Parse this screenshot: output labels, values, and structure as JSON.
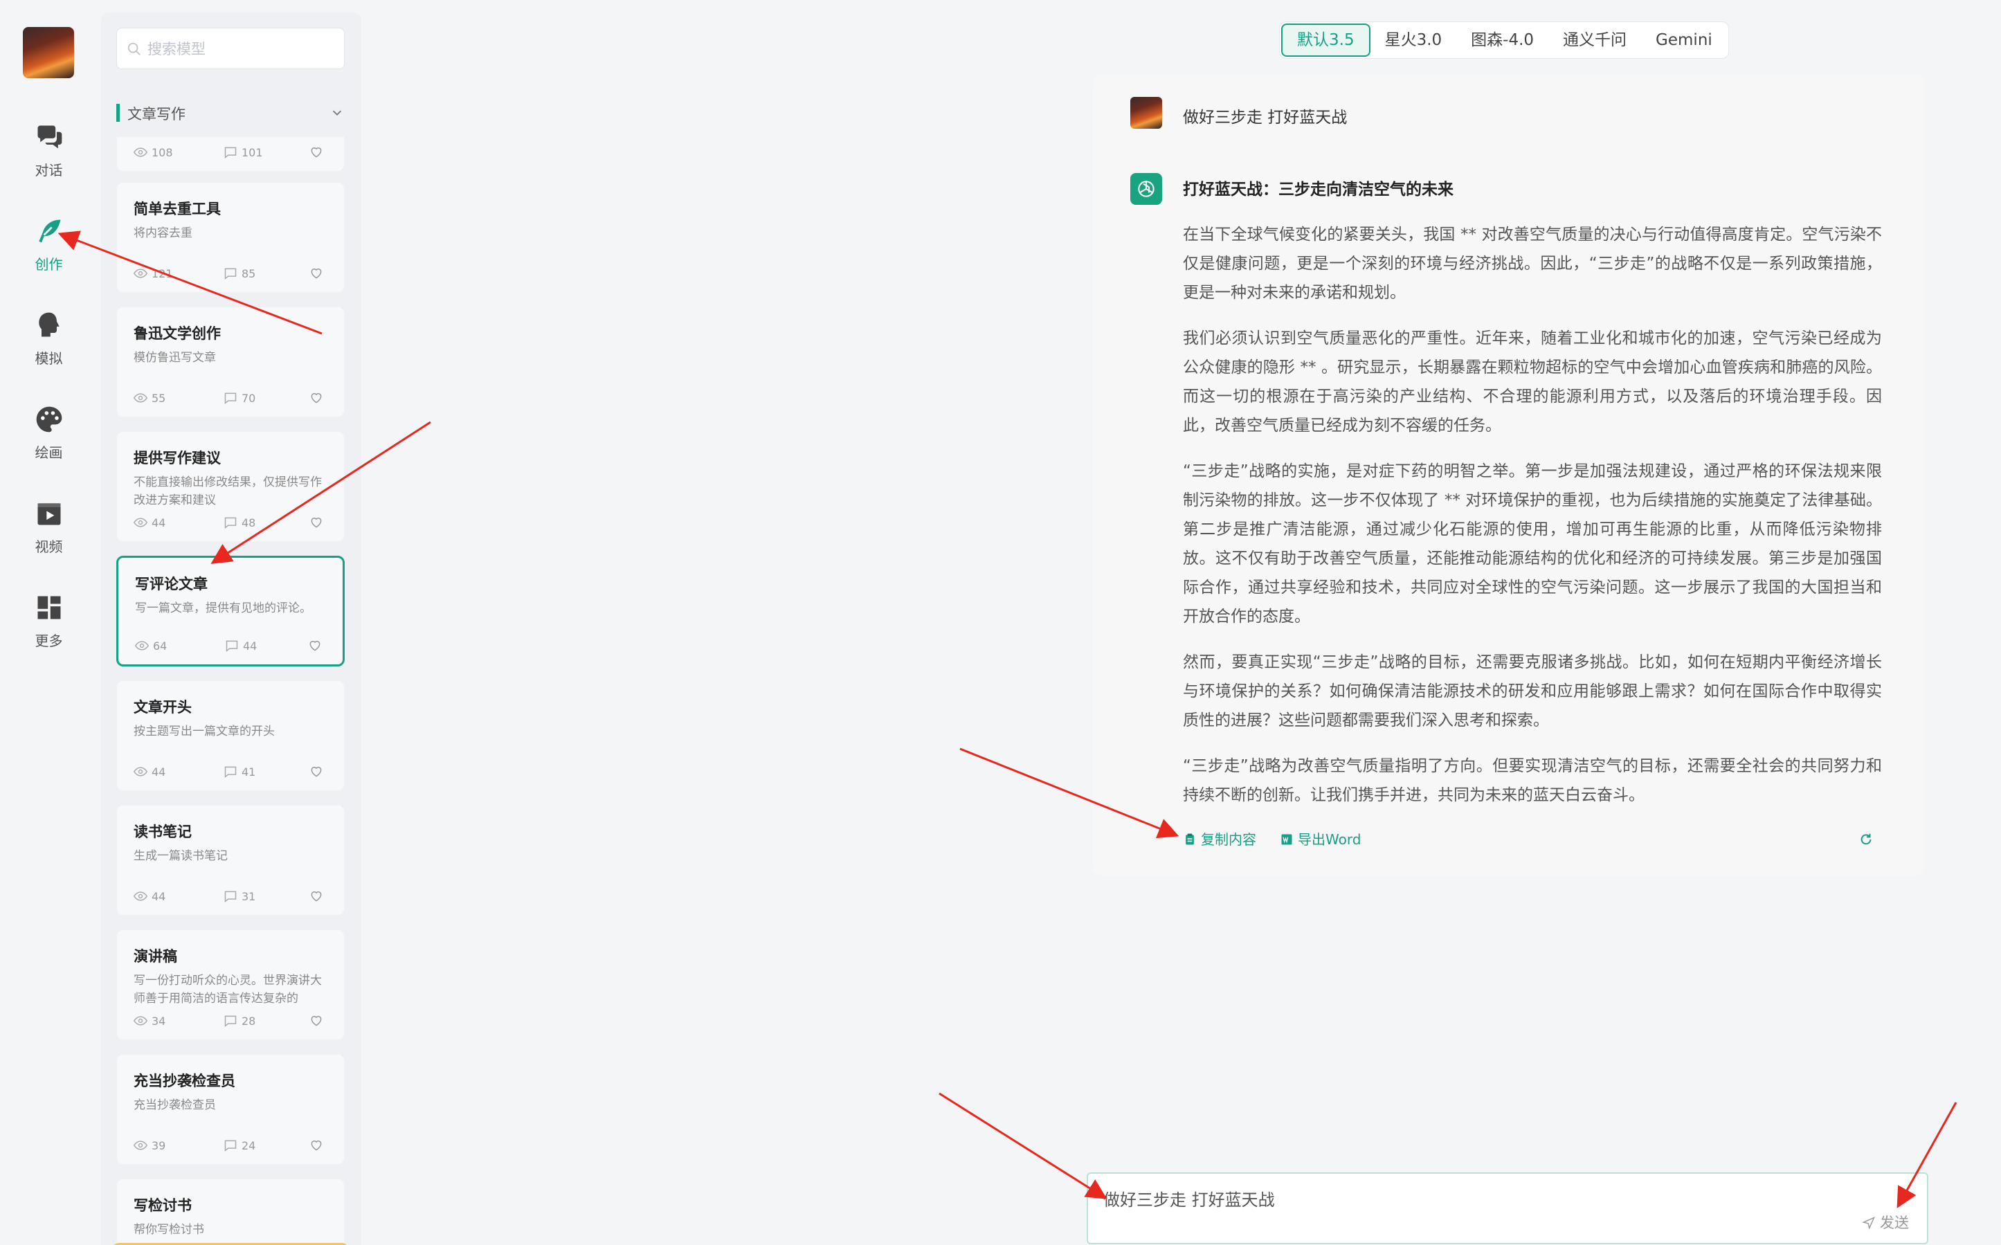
{
  "rail": {
    "items": [
      {
        "label": "对话",
        "icon": "chat-icon"
      },
      {
        "label": "创作",
        "icon": "feather-icon"
      },
      {
        "label": "模拟",
        "icon": "head-icon"
      },
      {
        "label": "绘画",
        "icon": "palette-icon"
      },
      {
        "label": "视频",
        "icon": "video-icon"
      },
      {
        "label": "更多",
        "icon": "grid-icon"
      }
    ],
    "active_index": 1
  },
  "panel": {
    "search_placeholder": "搜索模型",
    "category": "文章写作",
    "cards": [
      {
        "title": "",
        "desc": "",
        "views": "108",
        "comments": "101"
      },
      {
        "title": "简单去重工具",
        "desc": "将内容去重",
        "views": "121",
        "comments": "85"
      },
      {
        "title": "鲁迅文学创作",
        "desc": "模仿鲁迅写文章",
        "views": "55",
        "comments": "70"
      },
      {
        "title": "提供写作建议",
        "desc": "不能直接输出修改结果，仅提供写作改进方案和建议",
        "views": "44",
        "comments": "48"
      },
      {
        "title": "写评论文章",
        "desc": "写一篇文章，提供有见地的评论。",
        "views": "64",
        "comments": "44"
      },
      {
        "title": "文章开头",
        "desc": "按主题写出一篇文章的开头",
        "views": "44",
        "comments": "41"
      },
      {
        "title": "读书笔记",
        "desc": "生成一篇读书笔记",
        "views": "44",
        "comments": "31"
      },
      {
        "title": "演讲稿",
        "desc": "写一份打动听众的心灵。世界演讲大师善于用简洁的语言传达复杂的",
        "views": "34",
        "comments": "28"
      },
      {
        "title": "充当抄袭检查员",
        "desc": "充当抄袭检查员",
        "views": "39",
        "comments": "24"
      },
      {
        "title": "写检讨书",
        "desc": "帮你写检讨书",
        "views": "",
        "comments": ""
      }
    ]
  },
  "models": [
    "默认3.5",
    "星火3.0",
    "图森-4.0",
    "通义千问",
    "Gemini"
  ],
  "chat": {
    "user_message": "做好三步走 打好蓝天战",
    "answer_title": "打好蓝天战：三步走向清洁空气的未来",
    "paragraphs": [
      "在当下全球气候变化的紧要关头，我国 ** 对改善空气质量的决心与行动值得高度肯定。空气污染不仅是健康问题，更是一个深刻的环境与经济挑战。因此，“三步走”的战略不仅是一系列政策措施，更是一种对未来的承诺和规划。",
      "我们必须认识到空气质量恶化的严重性。近年来，随着工业化和城市化的加速，空气污染已经成为公众健康的隐形 ** 。研究显示，长期暴露在颗粒物超标的空气中会增加心血管疾病和肺癌的风险。而这一切的根源在于高污染的产业结构、不合理的能源利用方式，以及落后的环境治理手段。因此，改善空气质量已经成为刻不容缓的任务。",
      "“三步走”战略的实施，是对症下药的明智之举。第一步是加强法规建设，通过严格的环保法规来限制污染物的排放。这一步不仅体现了 ** 对环境保护的重视，也为后续措施的实施奠定了法律基础。第二步是推广清洁能源，通过减少化石能源的使用，增加可再生能源的比重，从而降低污染物排放。这不仅有助于改善空气质量，还能推动能源结构的优化和经济的可持续发展。第三步是加强国际合作，通过共享经验和技术，共同应对全球性的空气污染问题。这一步展示了我国的大国担当和开放合作的态度。",
      "然而，要真正实现“三步走”战略的目标，还需要克服诸多挑战。比如，如何在短期内平衡经济增长与环境保护的关系？如何确保清洁能源技术的研发和应用能够跟上需求？如何在国际合作中取得实质性的进展？这些问题都需要我们深入思考和探索。",
      "“三步走”战略为改善空气质量指明了方向。但要实现清洁空气的目标，还需要全社会的共同努力和持续不断的创新。让我们携手并进，共同为未来的蓝天白云奋斗。"
    ],
    "copy_label": "复制内容",
    "export_label": "导出Word"
  },
  "input": {
    "value": "做好三步走 打好蓝天战",
    "send_label": "发送"
  },
  "colors": {
    "accent": "#16a085",
    "annotation": "#e8281e"
  }
}
